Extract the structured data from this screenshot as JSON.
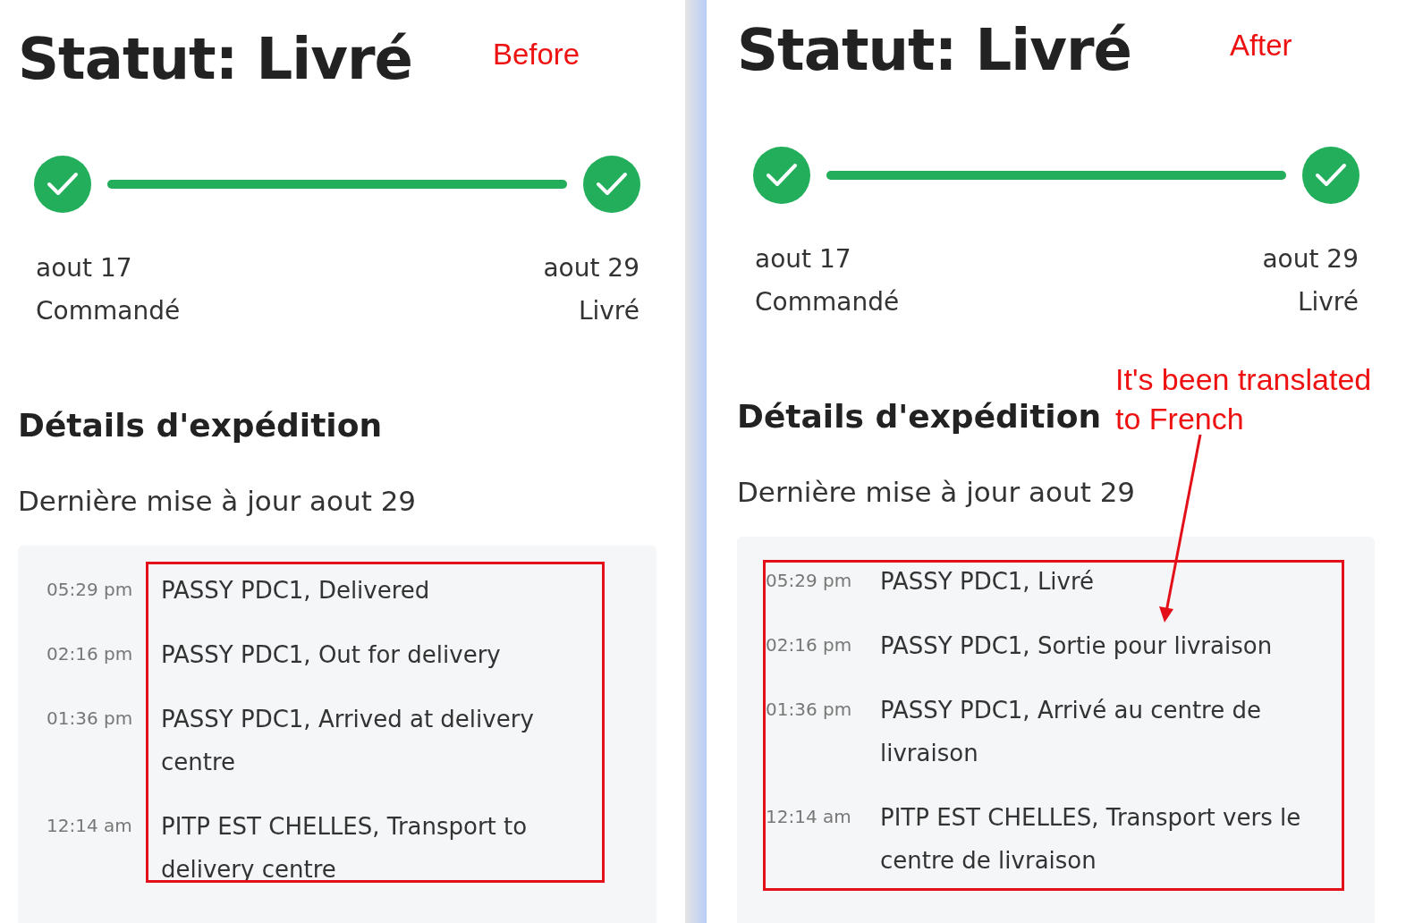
{
  "panels": [
    {
      "label": "Before",
      "title": "Statut: Livré",
      "progress": {
        "level": 1,
        "steps": [
          {
            "date": "aout 17",
            "label": "Commandé",
            "completed": true
          },
          {
            "date": "aout 29",
            "label": "Livré",
            "completed": true
          }
        ]
      },
      "section_title": "Détails d'expédition",
      "last_update": "Dernière mise à jour aout 29",
      "highlight": true,
      "events": [
        {
          "time": "05:29 pm",
          "text": "PASSY PDC1, Delivered"
        },
        {
          "time": "02:16 pm",
          "text": "PASSY PDC1, Out for delivery"
        },
        {
          "time": "01:36 pm",
          "text": "PASSY PDC1, Arrived at delivery centre"
        },
        {
          "time": "12:14 am",
          "text": "PITP EST CHELLES, Transport to delivery centre"
        }
      ]
    },
    {
      "label": "After",
      "title": "Statut: Livré",
      "progress": {
        "level": 1,
        "steps": [
          {
            "date": "aout 17",
            "label": "Commandé",
            "completed": true
          },
          {
            "date": "aout 29",
            "label": "Livré",
            "completed": true
          }
        ]
      },
      "section_title": "Détails d'expédition",
      "last_update": "Dernière mise à jour aout 29",
      "highlight": true,
      "note": "It's been translated to French",
      "events": [
        {
          "time": "05:29 pm",
          "text": "PASSY PDC1, Livré"
        },
        {
          "time": "02:16 pm",
          "text": "PASSY PDC1, Sortie pour livraison"
        },
        {
          "time": "01:36 pm",
          "text": "PASSY PDC1, Arrivé au centre de livraison"
        },
        {
          "time": "12:14 am",
          "text": "PITP EST CHELLES, Transport vers le centre de livraison"
        }
      ]
    }
  ]
}
